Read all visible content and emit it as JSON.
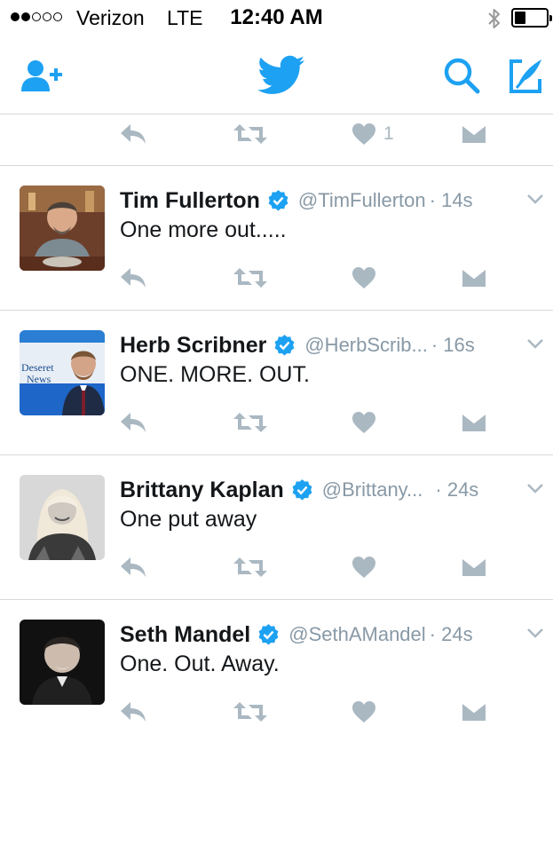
{
  "status_bar": {
    "carrier": "Verizon",
    "network": "LTE",
    "time": "12:40 AM",
    "signal_bars_filled": 2,
    "signal_bars_total": 5,
    "battery_level": 0.3
  },
  "nav": {
    "icons": [
      "add-user-icon",
      "twitter-bird-icon",
      "search-icon",
      "compose-icon"
    ],
    "accent_color": "#1da1f2"
  },
  "top_actions": {
    "like_count": "1"
  },
  "tweets": [
    {
      "name": "Tim Fullerton",
      "handle": "@TimFullerton",
      "time": "· 14s",
      "text": "One more out.....",
      "verified": true
    },
    {
      "name": "Herb Scribner",
      "handle": "@HerbScrib...",
      "time": "· 16s",
      "text": "ONE. MORE. OUT.",
      "verified": true,
      "avatar_text": "Deseret News"
    },
    {
      "name": "Brittany Kaplan",
      "handle": "@Brittany...",
      "time": "· 24s",
      "text": "One put away",
      "verified": true
    },
    {
      "name": "Seth Mandel",
      "handle": "@SethAMandel",
      "time": "· 24s",
      "text": "One. Out. Away.",
      "verified": true
    }
  ],
  "colors": {
    "icon_gray": "#aab8c2",
    "verified_blue": "#1da1f2",
    "text_secondary": "#8899a6"
  }
}
